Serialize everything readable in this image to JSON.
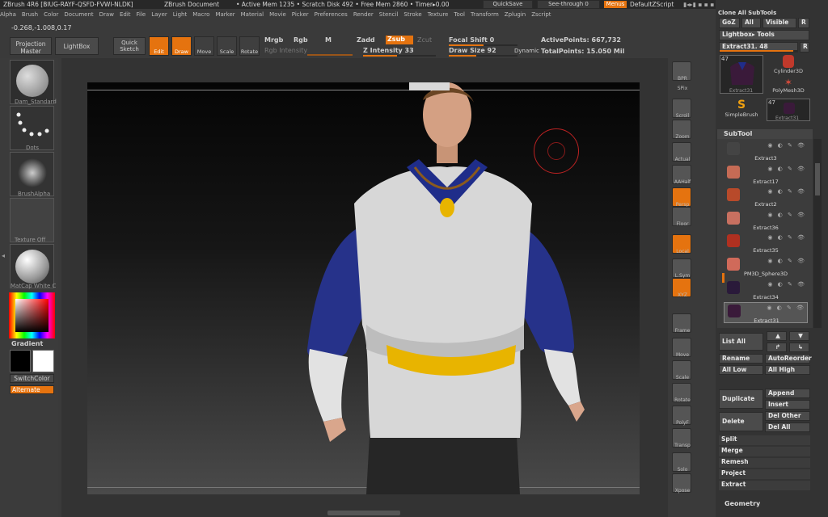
{
  "title_bar": {
    "app": "ZBrush 4R6 [BIUG-RAYF-QSFD-FVWI-NLDK]",
    "doc": "ZBrush Document",
    "mem": "• Active Mem 1235 • Scratch Disk 492 • Free Mem 2860 • Timer▸0.00",
    "quicksave": "QuickSave",
    "seethrough": "See-through  0",
    "menus": "Menus",
    "script": "DefaultZScript"
  },
  "menu": [
    "Alpha",
    "Brush",
    "Color",
    "Document",
    "Draw",
    "Edit",
    "File",
    "Layer",
    "Light",
    "Macro",
    "Marker",
    "Material",
    "Movie",
    "Picker",
    "Preferences",
    "Render",
    "Stencil",
    "Stroke",
    "Texture",
    "Tool",
    "Transform",
    "Zplugin",
    "Zscript"
  ],
  "coords": "-0.268,-1.008,0.17",
  "toolbar": {
    "projection": "Projection Master",
    "lightbox": "LightBox",
    "quick": "Quick Sketch",
    "edit": "Edit",
    "draw": "Draw",
    "move": "Move",
    "scale": "Scale",
    "rotate": "Rotate",
    "mrgb": "Mrgb",
    "rgb": "Rgb",
    "m": "M",
    "rgb_int": "Rgb Intensity",
    "zadd": "Zadd",
    "zsub": "Zsub",
    "zcut": "Zcut",
    "z_int": "Z Intensity 33",
    "focal": "Focal Shift 0",
    "draw_size": "Draw Size 92",
    "dynamic": "Dynamic",
    "active_pts": "ActivePoints: 667,732",
    "total_pts": "TotalPoints: 15.050 Mil",
    "z_int_value": 33,
    "draw_size_value": 92
  },
  "left": {
    "brush": "Dam_Standard",
    "stroke": "Dots",
    "alpha": "BrushAlpha",
    "texture": "Texture Off",
    "material": "MatCap White C",
    "gradient": "Gradient",
    "switch": "SwitchColor",
    "alternate": "Alternate"
  },
  "viewport_tools": [
    {
      "l": "BPR"
    },
    {
      "l": "SPix"
    },
    {
      "l": "Scroll"
    },
    {
      "l": "Zoom"
    },
    {
      "l": "Actual"
    },
    {
      "l": "AAHalf"
    },
    {
      "l": "Persp"
    },
    {
      "l": "Floor"
    },
    {
      "l": "Local"
    },
    {
      "l": "L.Sym"
    },
    {
      "l": "XYZ"
    },
    {
      "l": "Frame"
    },
    {
      "l": "Move"
    },
    {
      "l": "Scale"
    },
    {
      "l": "Rotate"
    },
    {
      "l": "PolyF"
    },
    {
      "l": "Transp"
    },
    {
      "l": "Solo"
    },
    {
      "l": "Xpose"
    }
  ],
  "right": {
    "clone": "Clone  All SubTools",
    "goz": "GoZ",
    "all": "All",
    "visible": "Visible",
    "r": "R",
    "lightbox_tools": "Lightbox▸ Tools",
    "tool_name": "Extract31. 48",
    "r2": "R",
    "thumbs": [
      "Extract31",
      "Cylinder3D",
      "PolyMesh3D",
      "SimpleBrush",
      "Extract31"
    ],
    "thumb_count": "47",
    "subtool": "SubTool",
    "subtools": [
      "Extract3",
      "Extract17",
      "Extract2",
      "Extract36",
      "Extract35",
      "PM3D_Sphere3D",
      "Extract34",
      "Extract31"
    ],
    "list_all": "List All",
    "rename": "Rename",
    "auto": "AutoReorder",
    "all_low": "All Low",
    "all_high": "All High",
    "duplicate": "Duplicate",
    "append": "Append",
    "insert": "Insert",
    "delete": "Delete",
    "del_other": "Del Other",
    "del_all": "Del All",
    "split": "Split",
    "merge": "Merge",
    "remesh": "Remesh",
    "project": "Project",
    "extract": "Extract",
    "geometry": "Geometry"
  }
}
